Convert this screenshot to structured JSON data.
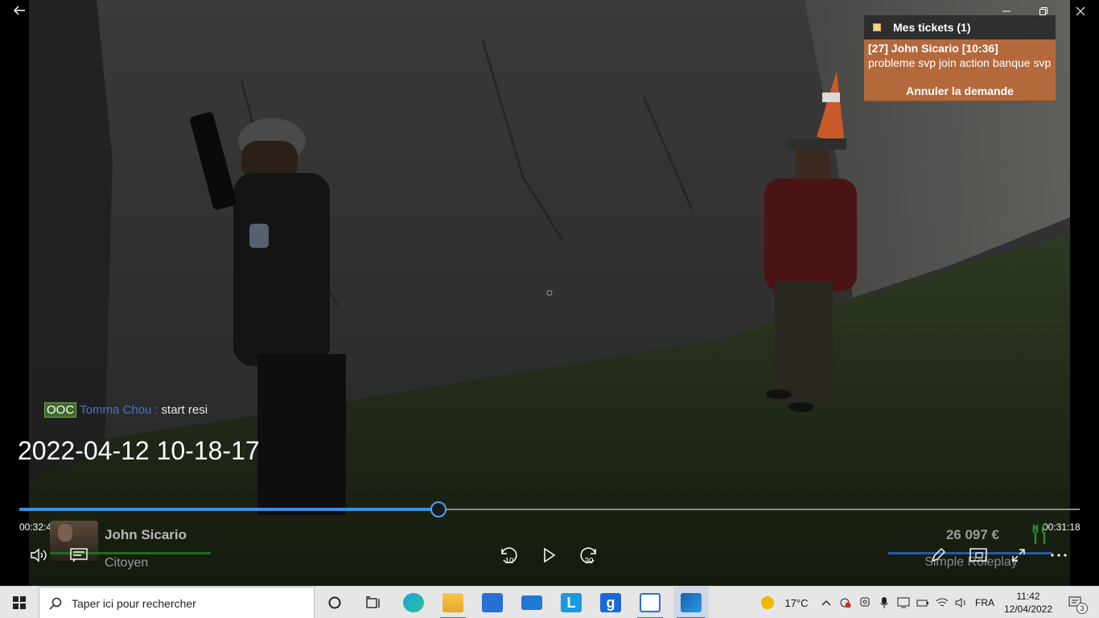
{
  "window": {
    "back_icon": "arrow-left-icon",
    "minimize_icon": "minimize-icon",
    "restore_icon": "restore-icon",
    "close_icon": "close-icon"
  },
  "tickets": {
    "header": "Mes tickets (1)",
    "ticket_title": "[27] John Sicario [10:36]",
    "ticket_message": "probleme svp join action banque svp",
    "cancel_label": "Annuler la demande"
  },
  "chat": {
    "tag": "OOC",
    "player": "Tomma Chou",
    "separator": ":",
    "message": "start resi"
  },
  "video": {
    "title": "2022-04-12 10-18-17",
    "elapsed": "00:32:49",
    "remaining": "00:31:18",
    "progress_fraction": 0.395
  },
  "hud": {
    "player_name": "John Sicario",
    "job": "Citoyen",
    "money": "26 097 €",
    "server": "Simple Roleplay"
  },
  "controls": {
    "rewind_label": "10",
    "forward_label": "30"
  },
  "taskbar": {
    "search_placeholder": "Taper ici pour rechercher",
    "weather_temp": "17°C",
    "language": "FRA",
    "time": "11:42",
    "date": "12/04/2022",
    "notification_count": "3"
  }
}
